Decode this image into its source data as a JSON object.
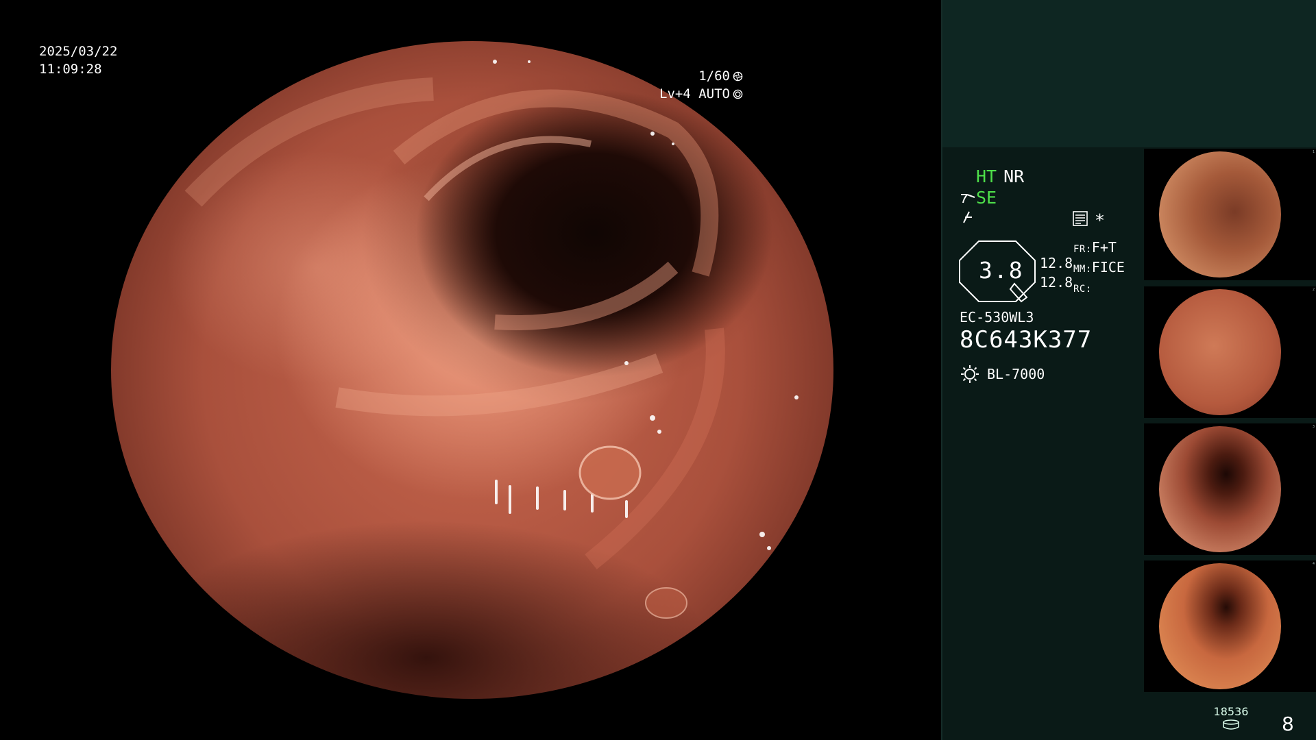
{
  "overlay": {
    "date": "2025/03/22",
    "time": "11:09:28",
    "shutter": "1/60",
    "shutter_icon": "aperture-icon",
    "level": "Lv+4 AUTO",
    "level_icon": "auto-ring-icon"
  },
  "panel": {
    "ht": "HT",
    "nr": "NR",
    "se": "SE",
    "se_icon": "scope-angle-icon",
    "f_icon": "filter-icon",
    "menu_icon": "list-menu-icon",
    "star": "*",
    "iris_value": "3.8",
    "gain_1": "12.8",
    "gain_2": "12.8",
    "fr_label": "FR:",
    "fr_value": "F+T",
    "mm_label": "MM:",
    "mm_value": "FICE",
    "rc_label": "RC:",
    "rc_value": "",
    "scope_model": "EC-530WL3",
    "serial": "8C643K377",
    "light_source": "BL-7000",
    "light_icon": "lamp-icon",
    "colors": {
      "accent_green": "#4ee04a",
      "panel_bg": "#0a1a17",
      "panel_top_bg": "#0e2622"
    }
  },
  "thumbnails": [
    {
      "index": "1"
    },
    {
      "index": "2"
    },
    {
      "index": "3"
    },
    {
      "index": "4"
    }
  ],
  "footer": {
    "counter": "18536",
    "counter_icon": "storage-drive-icon",
    "page_count": "8"
  }
}
